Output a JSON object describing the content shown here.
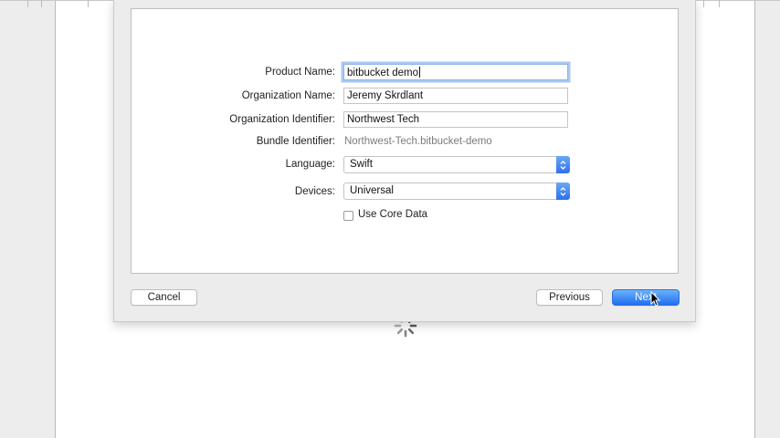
{
  "form": {
    "product_name": {
      "label": "Product Name:",
      "value": "bitbucket demo"
    },
    "organization_name": {
      "label": "Organization Name:",
      "value": "Jeremy Skrdlant"
    },
    "organization_identifier": {
      "label": "Organization Identifier:",
      "value": "Northwest Tech"
    },
    "bundle_identifier": {
      "label": "Bundle Identifier:",
      "value": "Northwest-Tech.bitbucket-demo"
    },
    "language": {
      "label": "Language:",
      "value": "Swift"
    },
    "devices": {
      "label": "Devices:",
      "value": "Universal"
    },
    "use_core_data": {
      "label": "Use Core Data",
      "checked": false
    }
  },
  "buttons": {
    "cancel": "Cancel",
    "previous": "Previous",
    "next": "Next"
  },
  "colors": {
    "accent": "#2d6ff0",
    "focus_ring": "#a9c8f1"
  },
  "icons": [
    "spinner-icon",
    "popup-arrows-icon",
    "mouse-cursor-icon"
  ]
}
